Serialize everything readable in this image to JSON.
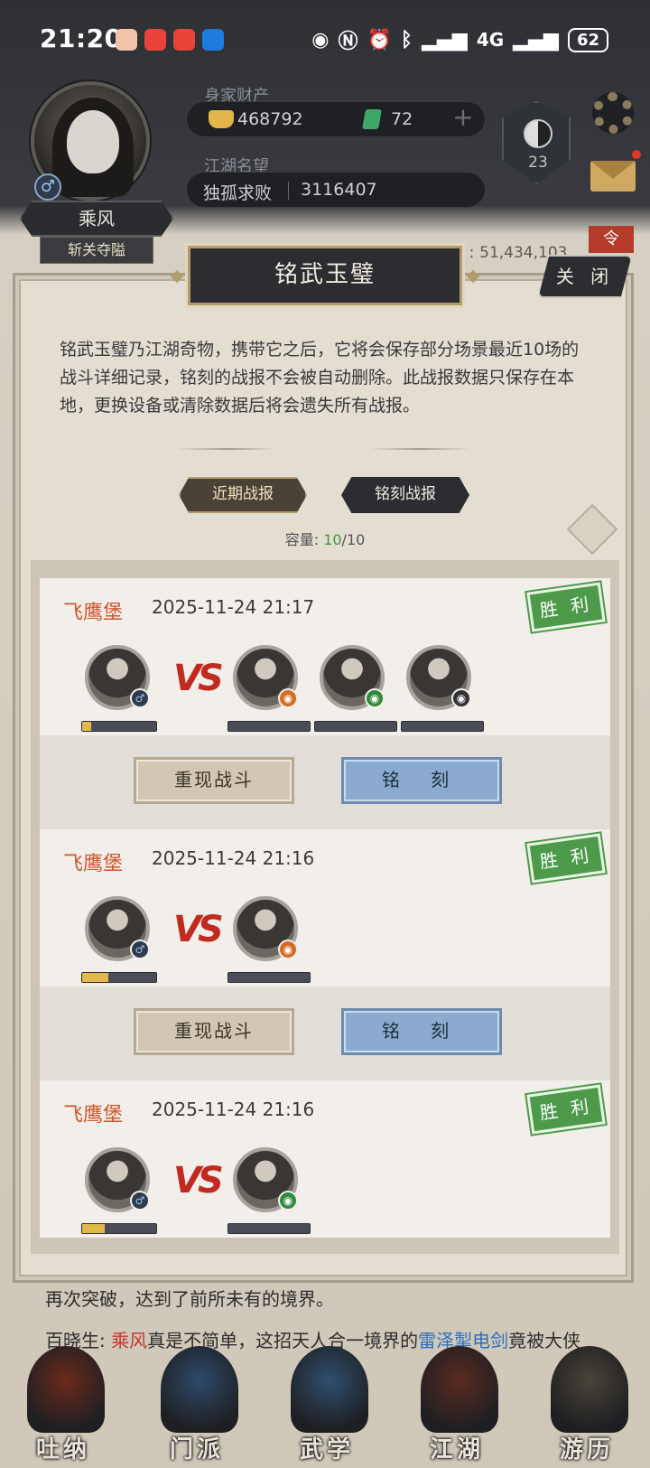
{
  "status_bar": {
    "time": "21:20",
    "app_icon_colors": [
      "#f2c3a8",
      "#e8443a",
      "#e8443a",
      "#1e7be0"
    ],
    "signal_label": "4G",
    "battery": "62"
  },
  "player": {
    "name": "乘风",
    "title_badge": "斩关夺隘",
    "gender_symbol": "♂",
    "wealth_label": "身家财产",
    "gold": "468792",
    "jade": "72",
    "fame_label": "江湖名望",
    "fame_title": "独孤求败",
    "fame_value": "3116407",
    "rank_level": "23"
  },
  "background": {
    "power_text": "ː 51,434,103",
    "log_lines": [
      {
        "parts": [
          {
            "t": "再次突破，达到了前所未有的境界。",
            "c": ""
          }
        ]
      },
      {
        "parts": [
          {
            "t": "百晓生: ",
            "c": ""
          },
          {
            "t": "乘风",
            "c": "hl"
          },
          {
            "t": "真是不简单，这招天人合一境界的",
            "c": ""
          },
          {
            "t": "雷泽掣电剑",
            "c": "hl-blue"
          },
          {
            "t": "竟被大侠",
            "c": ""
          }
        ]
      }
    ]
  },
  "modal": {
    "title": "铭武玉璧",
    "close_label": "关 闭",
    "description": "铭武玉璧乃江湖奇物，携带它之后，它将会保存部分场景最近10场的战斗详细记录，铭刻的战报不会被自动删除。此战报数据只保存在本地，更换设备或清除数据后将会遗失所有战报。",
    "tabs": [
      "近期战报",
      "铭刻战报"
    ],
    "capacity_label": "容量: ",
    "capacity_used": "10",
    "capacity_total": "/10",
    "accent_colors": {
      "location": "#d0542a",
      "victory": "#4c9a4a",
      "vs": "#c02a1f"
    }
  },
  "battles": [
    {
      "location": "飞鹰堡",
      "datetime": "2025-11-24 21:17",
      "result": "胜 利",
      "player_hp": 0.12,
      "opponents": [
        {
          "badge": "orange",
          "hp": 0
        },
        {
          "badge": "green",
          "hp": 0
        },
        {
          "badge": "dark",
          "hp": 0
        }
      ],
      "replay_label": "重现战斗",
      "engrave_label": "铭 刻"
    },
    {
      "location": "飞鹰堡",
      "datetime": "2025-11-24 21:16",
      "result": "胜 利",
      "player_hp": 0.35,
      "opponents": [
        {
          "badge": "orange",
          "hp": 0
        }
      ],
      "replay_label": "重现战斗",
      "engrave_label": "铭 刻"
    },
    {
      "location": "飞鹰堡",
      "datetime": "2025-11-24 21:16",
      "result": "胜 利",
      "player_hp": 0.3,
      "opponents": [
        {
          "badge": "green",
          "hp": 0
        }
      ]
    }
  ],
  "bottom_nav": [
    {
      "label": "吐纳",
      "art_color": "#6b2a1c"
    },
    {
      "label": "门派",
      "art_color": "#2d4a6b"
    },
    {
      "label": "武学",
      "art_color": "#2f4f6f"
    },
    {
      "label": "江湖",
      "art_color": "#5a2a20"
    },
    {
      "label": "游历",
      "art_color": "#4a4438"
    }
  ]
}
